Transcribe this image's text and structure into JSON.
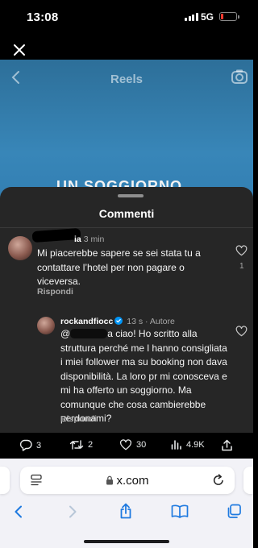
{
  "status_bar": {
    "time": "13:08",
    "network": "5G",
    "battery_level": 0.15
  },
  "reel": {
    "title": "Reels",
    "overlay_text": "UN SOGGIORNO"
  },
  "comments": {
    "title": "Commenti",
    "items": [
      {
        "username_visible": "ia",
        "time": "3 min",
        "text": "Mi piacerebbe sapere se sei stata tu a contattare l’hotel per non pagare o viceversa.",
        "reply_label": "Rispondi",
        "likes": "1"
      },
      {
        "username": "rockandfiocc",
        "time": "13 s",
        "author_label": "Autore",
        "mention_prefix": "@",
        "mention_suffix": "a",
        "text": "ciao! Ho scritto alla struttura perché me l hanno consigliata i miei follower ma su booking non dava disponibilità. La loro pr mi conosceva e mi ha offerto un soggiorno. Ma comunque che cosa cambierebbe perdonami?",
        "reply_label": "Rispondi"
      }
    ]
  },
  "tweet_actions": {
    "replies": "3",
    "reposts": "2",
    "likes": "30",
    "views": "4.9K"
  },
  "browser": {
    "url": "x.com"
  },
  "colors": {
    "sheet_bg": "#262626",
    "reel_blue": "#3886b8",
    "safari_accent": "#1f7ae0",
    "verified": "#0095f6"
  }
}
